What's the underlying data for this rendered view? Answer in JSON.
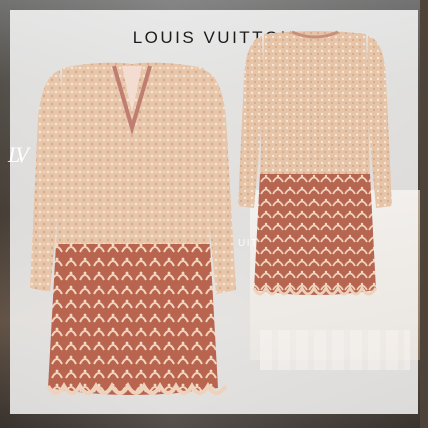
{
  "brand": {
    "title": "LOUIS VUITTON",
    "monogram": "LV",
    "storefront_sign": "UITTON"
  },
  "colors": {
    "lace_light": "#e8c8ad",
    "lace_dark": "#c98d72",
    "lining": "#b5654f",
    "card": "#ffffff"
  },
  "images": {
    "front_view": "dress-front-icon",
    "back_view": "dress-back-icon"
  }
}
